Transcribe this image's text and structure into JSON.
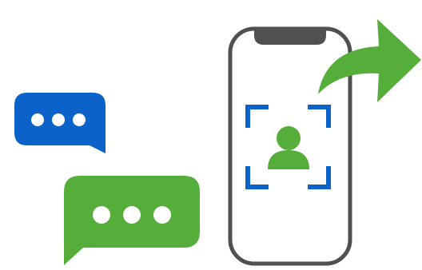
{
  "illustration": {
    "icons": {
      "message_bubble_blue": "speech-bubble-typing",
      "message_bubble_green": "speech-bubble-typing",
      "phone": "smartphone",
      "profile_scan": "person-in-scan-frame",
      "share_arrow": "curved-share-arrow"
    },
    "colors": {
      "blue": "#0b63c9",
      "green": "#55ad3a",
      "phone_outline": "#505050",
      "dots": "#ffffff",
      "background": "#ffffff"
    }
  }
}
